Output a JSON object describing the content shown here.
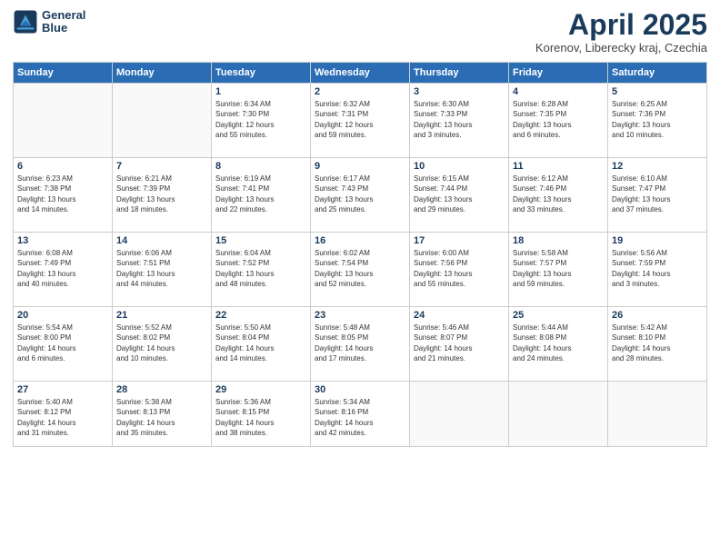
{
  "header": {
    "logo_line1": "General",
    "logo_line2": "Blue",
    "month_title": "April 2025",
    "location": "Korenov, Liberecky kraj, Czechia"
  },
  "weekdays": [
    "Sunday",
    "Monday",
    "Tuesday",
    "Wednesday",
    "Thursday",
    "Friday",
    "Saturday"
  ],
  "weeks": [
    [
      {
        "day": "",
        "info": ""
      },
      {
        "day": "",
        "info": ""
      },
      {
        "day": "1",
        "info": "Sunrise: 6:34 AM\nSunset: 7:30 PM\nDaylight: 12 hours\nand 55 minutes."
      },
      {
        "day": "2",
        "info": "Sunrise: 6:32 AM\nSunset: 7:31 PM\nDaylight: 12 hours\nand 59 minutes."
      },
      {
        "day": "3",
        "info": "Sunrise: 6:30 AM\nSunset: 7:33 PM\nDaylight: 13 hours\nand 3 minutes."
      },
      {
        "day": "4",
        "info": "Sunrise: 6:28 AM\nSunset: 7:35 PM\nDaylight: 13 hours\nand 6 minutes."
      },
      {
        "day": "5",
        "info": "Sunrise: 6:25 AM\nSunset: 7:36 PM\nDaylight: 13 hours\nand 10 minutes."
      }
    ],
    [
      {
        "day": "6",
        "info": "Sunrise: 6:23 AM\nSunset: 7:38 PM\nDaylight: 13 hours\nand 14 minutes."
      },
      {
        "day": "7",
        "info": "Sunrise: 6:21 AM\nSunset: 7:39 PM\nDaylight: 13 hours\nand 18 minutes."
      },
      {
        "day": "8",
        "info": "Sunrise: 6:19 AM\nSunset: 7:41 PM\nDaylight: 13 hours\nand 22 minutes."
      },
      {
        "day": "9",
        "info": "Sunrise: 6:17 AM\nSunset: 7:43 PM\nDaylight: 13 hours\nand 25 minutes."
      },
      {
        "day": "10",
        "info": "Sunrise: 6:15 AM\nSunset: 7:44 PM\nDaylight: 13 hours\nand 29 minutes."
      },
      {
        "day": "11",
        "info": "Sunrise: 6:12 AM\nSunset: 7:46 PM\nDaylight: 13 hours\nand 33 minutes."
      },
      {
        "day": "12",
        "info": "Sunrise: 6:10 AM\nSunset: 7:47 PM\nDaylight: 13 hours\nand 37 minutes."
      }
    ],
    [
      {
        "day": "13",
        "info": "Sunrise: 6:08 AM\nSunset: 7:49 PM\nDaylight: 13 hours\nand 40 minutes."
      },
      {
        "day": "14",
        "info": "Sunrise: 6:06 AM\nSunset: 7:51 PM\nDaylight: 13 hours\nand 44 minutes."
      },
      {
        "day": "15",
        "info": "Sunrise: 6:04 AM\nSunset: 7:52 PM\nDaylight: 13 hours\nand 48 minutes."
      },
      {
        "day": "16",
        "info": "Sunrise: 6:02 AM\nSunset: 7:54 PM\nDaylight: 13 hours\nand 52 minutes."
      },
      {
        "day": "17",
        "info": "Sunrise: 6:00 AM\nSunset: 7:56 PM\nDaylight: 13 hours\nand 55 minutes."
      },
      {
        "day": "18",
        "info": "Sunrise: 5:58 AM\nSunset: 7:57 PM\nDaylight: 13 hours\nand 59 minutes."
      },
      {
        "day": "19",
        "info": "Sunrise: 5:56 AM\nSunset: 7:59 PM\nDaylight: 14 hours\nand 3 minutes."
      }
    ],
    [
      {
        "day": "20",
        "info": "Sunrise: 5:54 AM\nSunset: 8:00 PM\nDaylight: 14 hours\nand 6 minutes."
      },
      {
        "day": "21",
        "info": "Sunrise: 5:52 AM\nSunset: 8:02 PM\nDaylight: 14 hours\nand 10 minutes."
      },
      {
        "day": "22",
        "info": "Sunrise: 5:50 AM\nSunset: 8:04 PM\nDaylight: 14 hours\nand 14 minutes."
      },
      {
        "day": "23",
        "info": "Sunrise: 5:48 AM\nSunset: 8:05 PM\nDaylight: 14 hours\nand 17 minutes."
      },
      {
        "day": "24",
        "info": "Sunrise: 5:46 AM\nSunset: 8:07 PM\nDaylight: 14 hours\nand 21 minutes."
      },
      {
        "day": "25",
        "info": "Sunrise: 5:44 AM\nSunset: 8:08 PM\nDaylight: 14 hours\nand 24 minutes."
      },
      {
        "day": "26",
        "info": "Sunrise: 5:42 AM\nSunset: 8:10 PM\nDaylight: 14 hours\nand 28 minutes."
      }
    ],
    [
      {
        "day": "27",
        "info": "Sunrise: 5:40 AM\nSunset: 8:12 PM\nDaylight: 14 hours\nand 31 minutes."
      },
      {
        "day": "28",
        "info": "Sunrise: 5:38 AM\nSunset: 8:13 PM\nDaylight: 14 hours\nand 35 minutes."
      },
      {
        "day": "29",
        "info": "Sunrise: 5:36 AM\nSunset: 8:15 PM\nDaylight: 14 hours\nand 38 minutes."
      },
      {
        "day": "30",
        "info": "Sunrise: 5:34 AM\nSunset: 8:16 PM\nDaylight: 14 hours\nand 42 minutes."
      },
      {
        "day": "",
        "info": ""
      },
      {
        "day": "",
        "info": ""
      },
      {
        "day": "",
        "info": ""
      }
    ]
  ]
}
